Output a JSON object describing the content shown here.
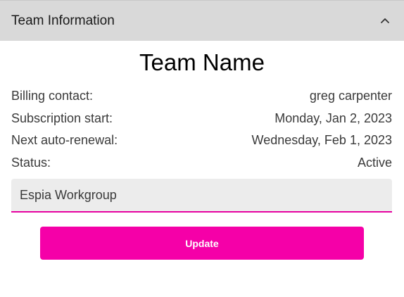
{
  "accordion": {
    "title": "Team Information",
    "expanded": true
  },
  "team": {
    "heading": "Team Name",
    "details": [
      {
        "label": "Billing contact:",
        "value": "greg carpenter"
      },
      {
        "label": "Subscription start:",
        "value": "Monday, Jan 2, 2023"
      },
      {
        "label": "Next auto-renewal:",
        "value": "Wednesday, Feb 1, 2023"
      },
      {
        "label": "Status:",
        "value": "Active"
      }
    ],
    "name_input_value": "Espia Workgroup"
  },
  "actions": {
    "update_label": "Update"
  },
  "colors": {
    "accent": "#f500a8",
    "header_bg": "#d9d9d9",
    "input_bg": "#ececec"
  },
  "icons": {
    "collapse": "chevron-up-icon"
  }
}
